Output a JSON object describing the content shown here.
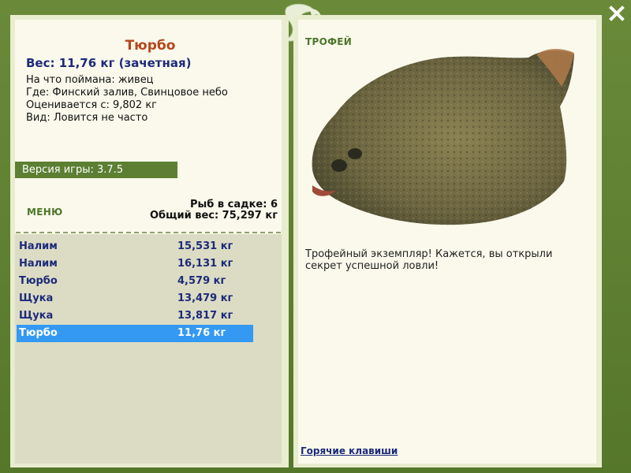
{
  "catch": {
    "name": "Тюрбо",
    "weight_line": "Вес: 11,76 кг (зачетная)",
    "bait": "На что поймана: живец",
    "location": "Где: Финский залив, Свинцовое небо",
    "value": "Оценивается с: 9,802 кг",
    "kind": "Вид: Ловится не часто"
  },
  "version": "Версия игры: 3.7.5",
  "menu_label": "МЕНЮ",
  "cage": {
    "count": "Рыб в садке: 6",
    "total": "Общий вес: 75,297 кг"
  },
  "fish_list": [
    {
      "name": "Налим",
      "weight": "15,531 кг"
    },
    {
      "name": "Налим",
      "weight": "16,131 кг"
    },
    {
      "name": "Тюрбо",
      "weight": "4,579 кг"
    },
    {
      "name": "Щука",
      "weight": "13,479 кг"
    },
    {
      "name": "Щука",
      "weight": "13,817 кг"
    },
    {
      "name": "Тюрбо",
      "weight": "11,76 кг"
    }
  ],
  "selected_index": 5,
  "trophy_label": "ТРОФЕЙ",
  "description": "Трофейный экземпляр! Кажется, вы открыли секрет успешной ловли!",
  "hotkeys": "Горячие клавиши",
  "colors": {
    "frame_green": "#5e7f31",
    "panel_bg": "#faf9ec",
    "selection": "#3399f3",
    "title_orange": "#b5471a",
    "text_navy": "#1d2a7a"
  }
}
